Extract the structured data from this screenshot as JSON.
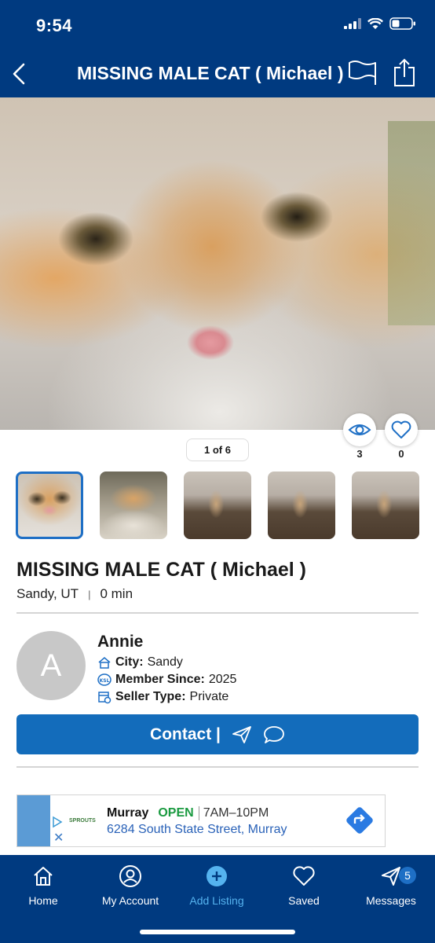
{
  "status_bar": {
    "time": "9:54"
  },
  "header": {
    "title": "MISSING MALE CAT ( Michael )"
  },
  "gallery": {
    "counter": "1 of 6",
    "views": "3",
    "likes": "0",
    "thumbnails": [
      {
        "alt": "cat face close-up"
      },
      {
        "alt": "cat on bed"
      },
      {
        "alt": "cat sitting on floor"
      },
      {
        "alt": "cat sitting on floor"
      },
      {
        "alt": "cat sitting on floor"
      }
    ]
  },
  "listing": {
    "title": "MISSING MALE CAT ( Michael )",
    "location": "Sandy, UT",
    "age": "0 min"
  },
  "seller": {
    "avatar_initial": "A",
    "name": "Annie",
    "city_label": "City:",
    "city": "Sandy",
    "member_label": "Member Since:",
    "member_since": "2025",
    "type_label": "Seller Type:",
    "type": "Private"
  },
  "contact": {
    "label": "Contact |"
  },
  "ad": {
    "logo": "SPROUTS",
    "name": "Murray",
    "status": "OPEN",
    "hours": "7AM–10PM",
    "address": "6284 South State Street, Murray"
  },
  "tab_bar": {
    "home": "Home",
    "account": "My Account",
    "add": "Add Listing",
    "saved": "Saved",
    "messages": "Messages",
    "messages_badge": "5"
  },
  "colors": {
    "nav_blue": "#003a80",
    "button_blue": "#136cbb",
    "active_tab": "#55b3ef",
    "open_green": "#1a9a40"
  }
}
